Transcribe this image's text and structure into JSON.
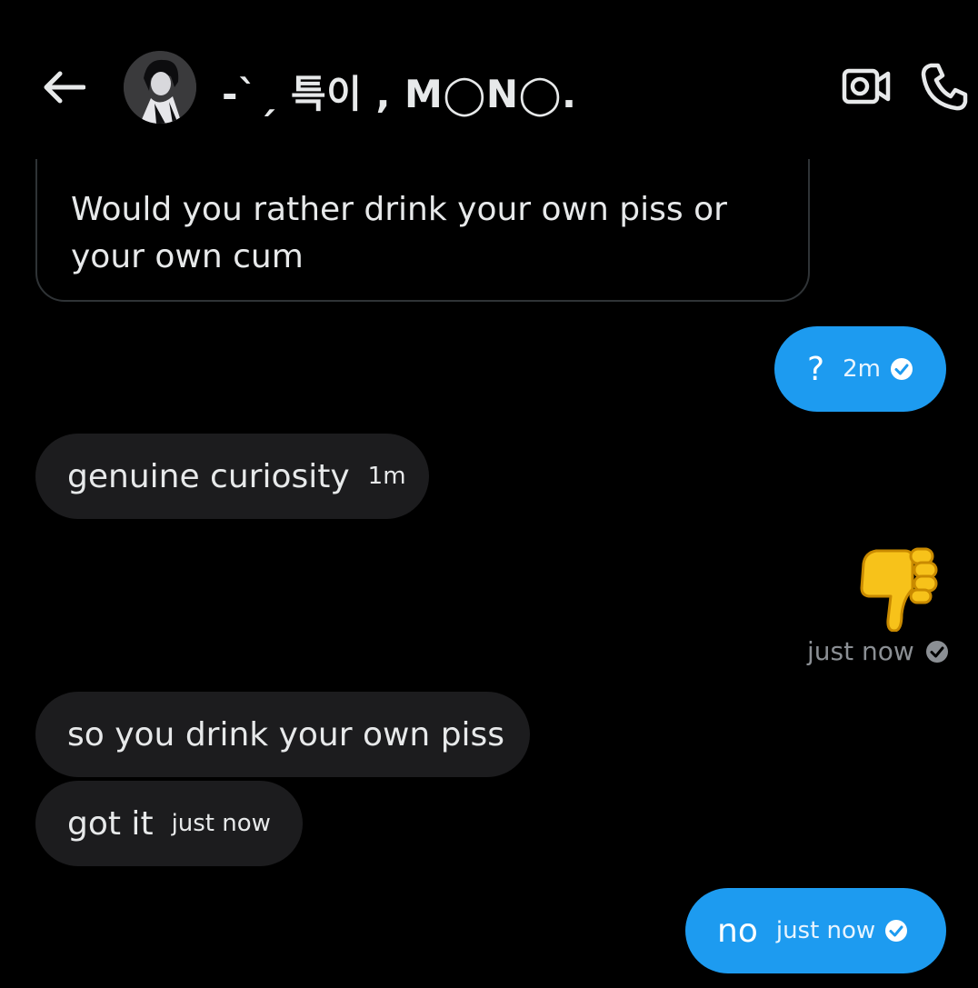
{
  "header": {
    "title": "-ˋˏ 특이 , M◯N◯.",
    "back_icon": "arrow-left-icon",
    "video_icon": "video-camera-icon",
    "call_icon": "phone-icon"
  },
  "colors": {
    "background": "#000000",
    "my_bubble": "#1d9bf0",
    "their_bubble": "#1c1c1e",
    "text": "#e7e9ea",
    "muted": "#8b8f94"
  },
  "quoted": {
    "text": "Would you rather drink your own piss or your own cum"
  },
  "messages": [
    {
      "from": "me",
      "text": "?",
      "time": "2m",
      "status": "seen"
    },
    {
      "from": "them",
      "text": "genuine curiosity",
      "time": "1m"
    },
    {
      "from": "me",
      "text": "👎",
      "time": "just now",
      "status": "sent"
    },
    {
      "from": "them",
      "text": "so you drink your own piss",
      "time": ""
    },
    {
      "from": "them",
      "text": "got it",
      "time": "just now"
    },
    {
      "from": "me",
      "text": "no",
      "time": "just now",
      "status": "seen"
    }
  ]
}
